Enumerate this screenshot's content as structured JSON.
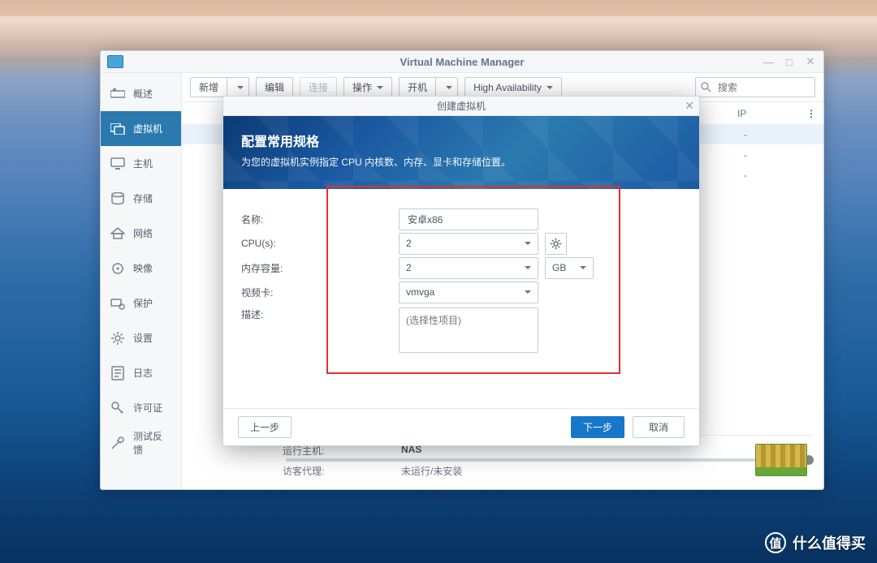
{
  "window": {
    "title": "Virtual Machine Manager"
  },
  "sidebar": {
    "items": [
      {
        "label": "概述",
        "icon": "overview"
      },
      {
        "label": "虚拟机",
        "icon": "vm"
      },
      {
        "label": "主机",
        "icon": "host"
      },
      {
        "label": "存储",
        "icon": "storage"
      },
      {
        "label": "网络",
        "icon": "network"
      },
      {
        "label": "映像",
        "icon": "image"
      },
      {
        "label": "保护",
        "icon": "protect"
      },
      {
        "label": "设置",
        "icon": "settings"
      },
      {
        "label": "日志",
        "icon": "log"
      },
      {
        "label": "许可证",
        "icon": "license"
      },
      {
        "label": "测试反馈",
        "icon": "feedback"
      }
    ],
    "activeIndex": 1
  },
  "toolbar": {
    "new": "新增",
    "edit": "编辑",
    "connect": "连接",
    "operate": "操作",
    "power": "开机",
    "ha": "High Availability"
  },
  "search": {
    "placeholder": "搜索",
    "value": ""
  },
  "table": {
    "col_ip": "IP",
    "dash": "-"
  },
  "detail": {
    "run_host_label": "运行主机:",
    "run_host_value": "NAS",
    "guest_label": "访客代理:",
    "guest_value": "未运行/未安装"
  },
  "dialog": {
    "title": "创建虚拟机",
    "banner_title": "配置常用规格",
    "banner_desc": "为您的虚拟机实例指定 CPU 内核数、内存、显卡和存储位置。",
    "fields": {
      "name_label": "名称:",
      "name_value": "安卓x86",
      "cpu_label": "CPU(s):",
      "cpu_value": "2",
      "mem_label": "内存容量:",
      "mem_value": "2",
      "mem_unit": "GB",
      "video_label": "视频卡:",
      "video_value": "vmvga",
      "desc_label": "描述:",
      "desc_placeholder": "(选择性项目)"
    },
    "buttons": {
      "prev": "上一步",
      "next": "下一步",
      "cancel": "取消"
    }
  },
  "watermark": {
    "glyph": "值",
    "text": "什么值得买"
  }
}
